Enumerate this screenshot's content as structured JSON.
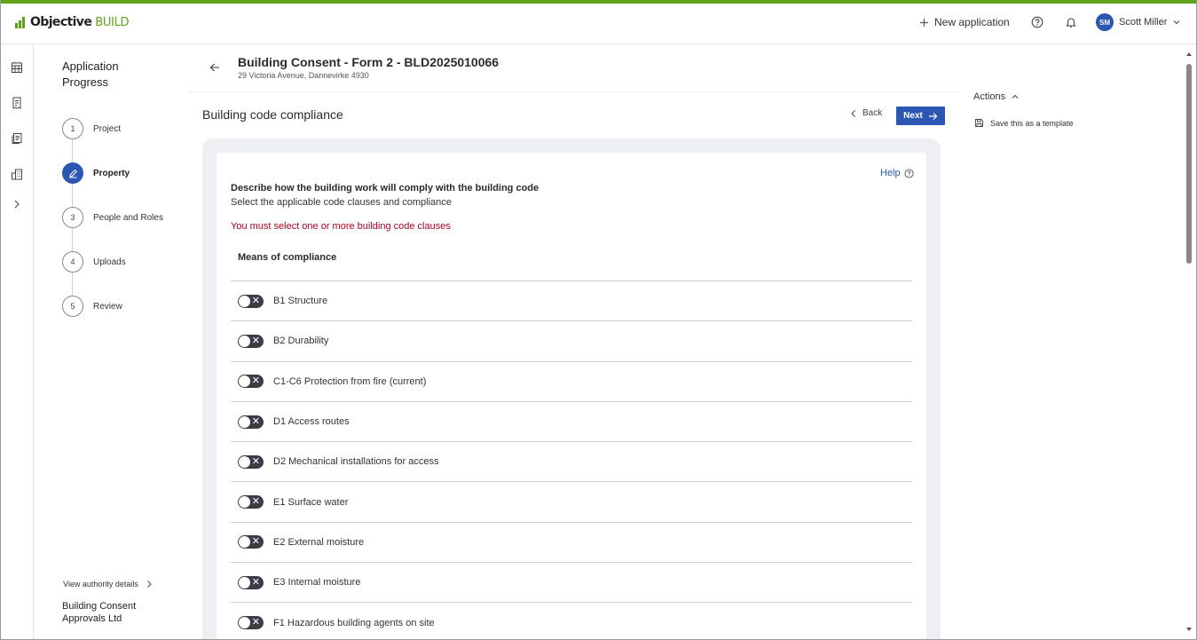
{
  "app": {
    "brand_bold": "Objective",
    "brand_light": "BUILD",
    "accent_color": "#5fa31a",
    "primary_color": "#2b56b3",
    "error_color": "#b00020"
  },
  "header": {
    "new_application": "New application",
    "help_icon": "help-circle-icon",
    "bell_icon": "bell-icon",
    "user_initials": "SM",
    "user_name": "Scott Miller"
  },
  "rail": {
    "icons": [
      "calendar-icon",
      "receipt-icon",
      "documents-icon",
      "buildings-icon",
      "chevron-right-icon"
    ]
  },
  "progress": {
    "title": "Application Progress",
    "steps": [
      {
        "num": "1",
        "label": "Project",
        "state": "default"
      },
      {
        "num": "",
        "label": "Property",
        "state": "active"
      },
      {
        "num": "3",
        "label": "People and Roles",
        "state": "default"
      },
      {
        "num": "4",
        "label": "Uploads",
        "state": "default"
      },
      {
        "num": "5",
        "label": "Review",
        "state": "default"
      }
    ],
    "authority_link": "View authority details",
    "authority_name": "Building Consent Approvals Ltd"
  },
  "page": {
    "form_title": "Building Consent - Form 2 - BLD2025010066",
    "address": "29 Victoria Avenue, Dannevirke 4930",
    "section_title": "Building code compliance",
    "back_label": "Back",
    "next_label": "Next"
  },
  "form": {
    "help": "Help",
    "description_title": "Describe how the building work will comply with the building code",
    "description_sub": "Select the applicable code clauses and compliance",
    "error": "You must select one or more building code clauses",
    "means_title": "Means of compliance",
    "clauses": [
      {
        "label": "B1 Structure",
        "on": false
      },
      {
        "label": "B2 Durability",
        "on": false
      },
      {
        "label": "C1-C6 Protection from fire (current)",
        "on": false
      },
      {
        "label": "D1 Access routes",
        "on": false
      },
      {
        "label": "D2 Mechanical installations for access",
        "on": false
      },
      {
        "label": "E1 Surface water",
        "on": false
      },
      {
        "label": "E2 External moisture",
        "on": false
      },
      {
        "label": "E3 Internal moisture",
        "on": false
      },
      {
        "label": "F1 Hazardous building agents on site",
        "on": false
      }
    ]
  },
  "actions": {
    "title": "Actions",
    "save_template": "Save this as a template"
  }
}
